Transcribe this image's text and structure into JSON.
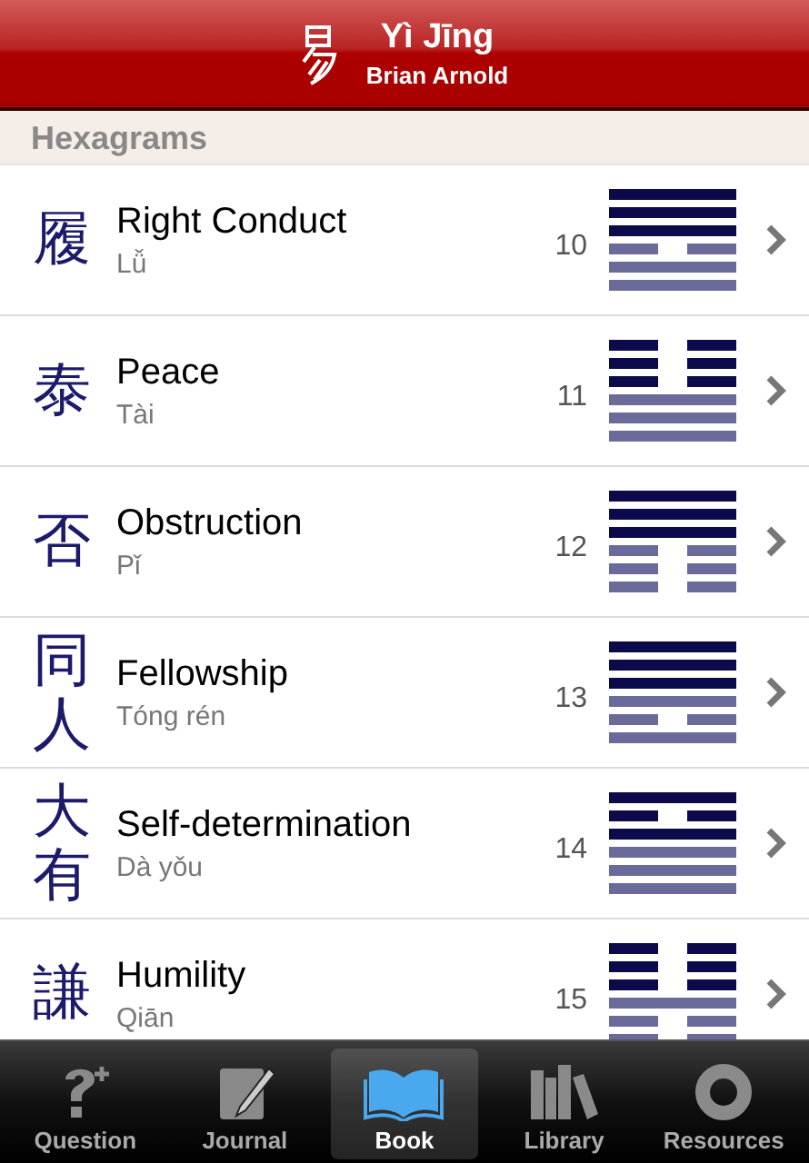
{
  "header": {
    "title": "Yì Jīng",
    "subtitle": "Brian Arnold"
  },
  "section": {
    "title": "Hexagrams"
  },
  "hexagrams": [
    {
      "character": "履",
      "name": "Right Conduct",
      "pinyin": "Lǚ",
      "number": "10",
      "lines": [
        {
          "broken": false
        },
        {
          "broken": false
        },
        {
          "broken": false
        },
        {
          "broken": true
        },
        {
          "broken": false
        },
        {
          "broken": false
        }
      ]
    },
    {
      "character": "泰",
      "name": "Peace",
      "pinyin": "Tài",
      "number": "11",
      "lines": [
        {
          "broken": true
        },
        {
          "broken": true
        },
        {
          "broken": true
        },
        {
          "broken": false
        },
        {
          "broken": false
        },
        {
          "broken": false
        }
      ]
    },
    {
      "character": "否",
      "name": "Obstruction",
      "pinyin": "Pǐ",
      "number": "12",
      "lines": [
        {
          "broken": false
        },
        {
          "broken": false
        },
        {
          "broken": false
        },
        {
          "broken": true
        },
        {
          "broken": true
        },
        {
          "broken": true
        }
      ]
    },
    {
      "character": "同人",
      "name": "Fellowship",
      "pinyin": "Tóng rén",
      "number": "13",
      "lines": [
        {
          "broken": false
        },
        {
          "broken": false
        },
        {
          "broken": false
        },
        {
          "broken": false
        },
        {
          "broken": true
        },
        {
          "broken": false
        }
      ]
    },
    {
      "character": "大有",
      "name": "Self-determination",
      "pinyin": "Dà yǒu",
      "number": "14",
      "lines": [
        {
          "broken": false
        },
        {
          "broken": true
        },
        {
          "broken": false
        },
        {
          "broken": false
        },
        {
          "broken": false
        },
        {
          "broken": false
        }
      ]
    },
    {
      "character": "謙",
      "name": "Humility",
      "pinyin": "Qiān",
      "number": "15",
      "lines": [
        {
          "broken": true
        },
        {
          "broken": true
        },
        {
          "broken": true
        },
        {
          "broken": false
        },
        {
          "broken": true
        },
        {
          "broken": true
        }
      ]
    }
  ],
  "tabs": [
    {
      "label": "Question",
      "selected": false
    },
    {
      "label": "Journal",
      "selected": false
    },
    {
      "label": "Book",
      "selected": true
    },
    {
      "label": "Library",
      "selected": false
    },
    {
      "label": "Resources",
      "selected": false
    }
  ]
}
